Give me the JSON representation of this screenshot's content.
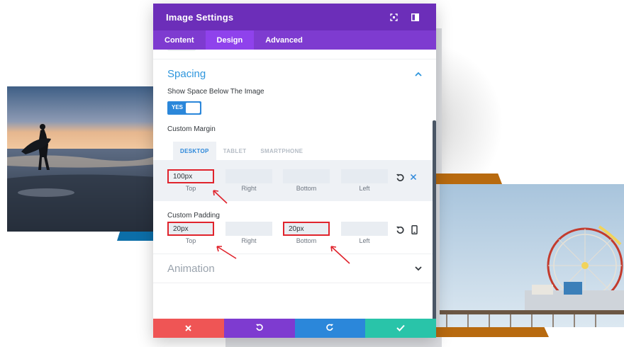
{
  "modal": {
    "title": "Image Settings",
    "header_icons": [
      "expand-icon",
      "sidebar-icon"
    ],
    "tabs": [
      {
        "label": "Content",
        "active": false
      },
      {
        "label": "Design",
        "active": true
      },
      {
        "label": "Advanced",
        "active": false
      }
    ]
  },
  "spacing": {
    "title": "Spacing",
    "show_space_label": "Show Space Below The Image",
    "toggle_value": "YES",
    "custom_margin": {
      "label": "Custom Margin",
      "device_tabs": [
        {
          "label": "DESKTOP",
          "active": true
        },
        {
          "label": "TABLET",
          "active": false
        },
        {
          "label": "SMARTPHONE",
          "active": false
        }
      ],
      "fields": [
        {
          "caption": "Top",
          "value": "100px",
          "highlighted": true
        },
        {
          "caption": "Right",
          "value": "",
          "highlighted": false
        },
        {
          "caption": "Bottom",
          "value": "",
          "highlighted": false
        },
        {
          "caption": "Left",
          "value": "",
          "highlighted": false
        }
      ]
    },
    "custom_padding": {
      "label": "Custom Padding",
      "fields": [
        {
          "caption": "Top",
          "value": "20px",
          "highlighted": true
        },
        {
          "caption": "Right",
          "value": "",
          "highlighted": false
        },
        {
          "caption": "Bottom",
          "value": "20px",
          "highlighted": true
        },
        {
          "caption": "Left",
          "value": "",
          "highlighted": false
        }
      ]
    }
  },
  "animation": {
    "title": "Animation"
  },
  "footer": {
    "buttons": [
      "cancel",
      "undo",
      "redo",
      "save"
    ]
  },
  "colors": {
    "header": "#6c2eb9",
    "tabs_bar": "#7e3bd0",
    "active_tab": "#8f42ec",
    "accent_blue": "#2b87da",
    "cancel": "#ef5555",
    "undo": "#7e3bd0",
    "redo": "#2b87da",
    "save": "#29c4a9",
    "highlight": "#e0232c"
  }
}
